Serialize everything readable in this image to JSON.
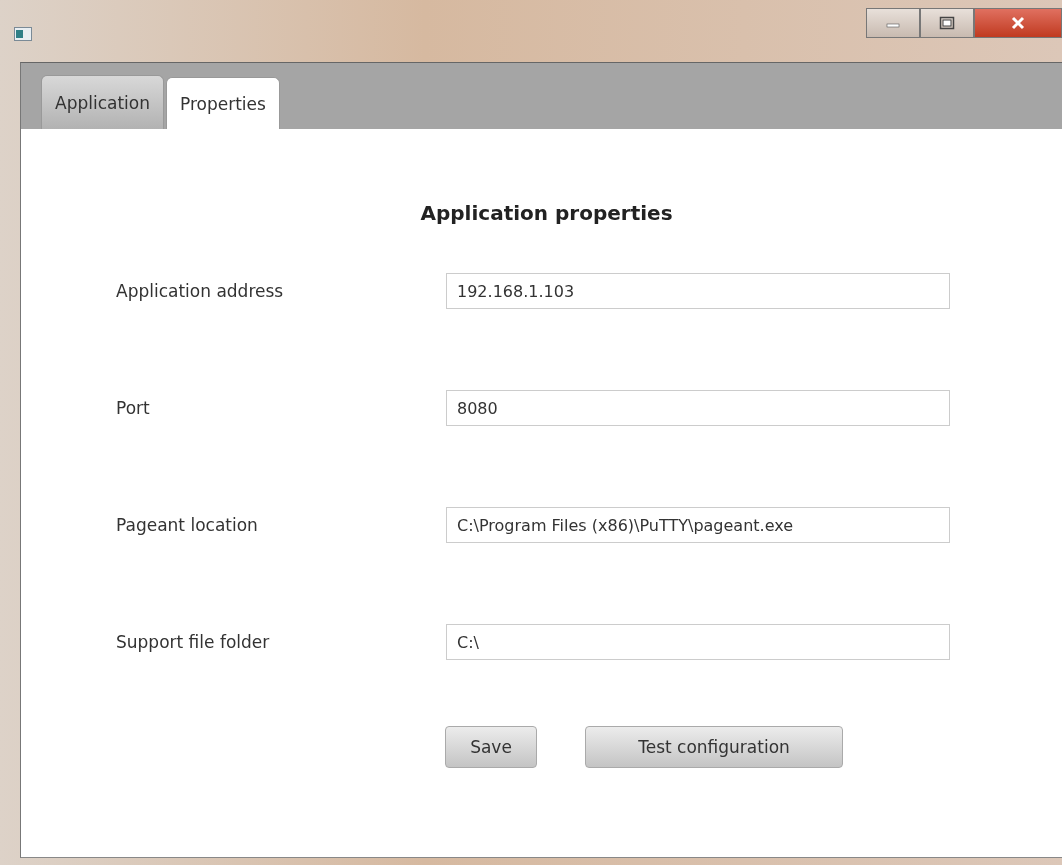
{
  "tabs": [
    {
      "label": "Application",
      "selected": false
    },
    {
      "label": "Properties",
      "selected": true
    }
  ],
  "heading": "Application properties",
  "fields": [
    {
      "label": "Application address",
      "value": "192.168.1.103"
    },
    {
      "label": "Port",
      "value": "8080"
    },
    {
      "label": "Pageant location",
      "value": "C:\\Program Files (x86)\\PuTTY\\pageant.exe"
    },
    {
      "label": "Support file folder",
      "value": "C:\\"
    }
  ],
  "buttons": [
    "Save",
    "Test configuration"
  ]
}
